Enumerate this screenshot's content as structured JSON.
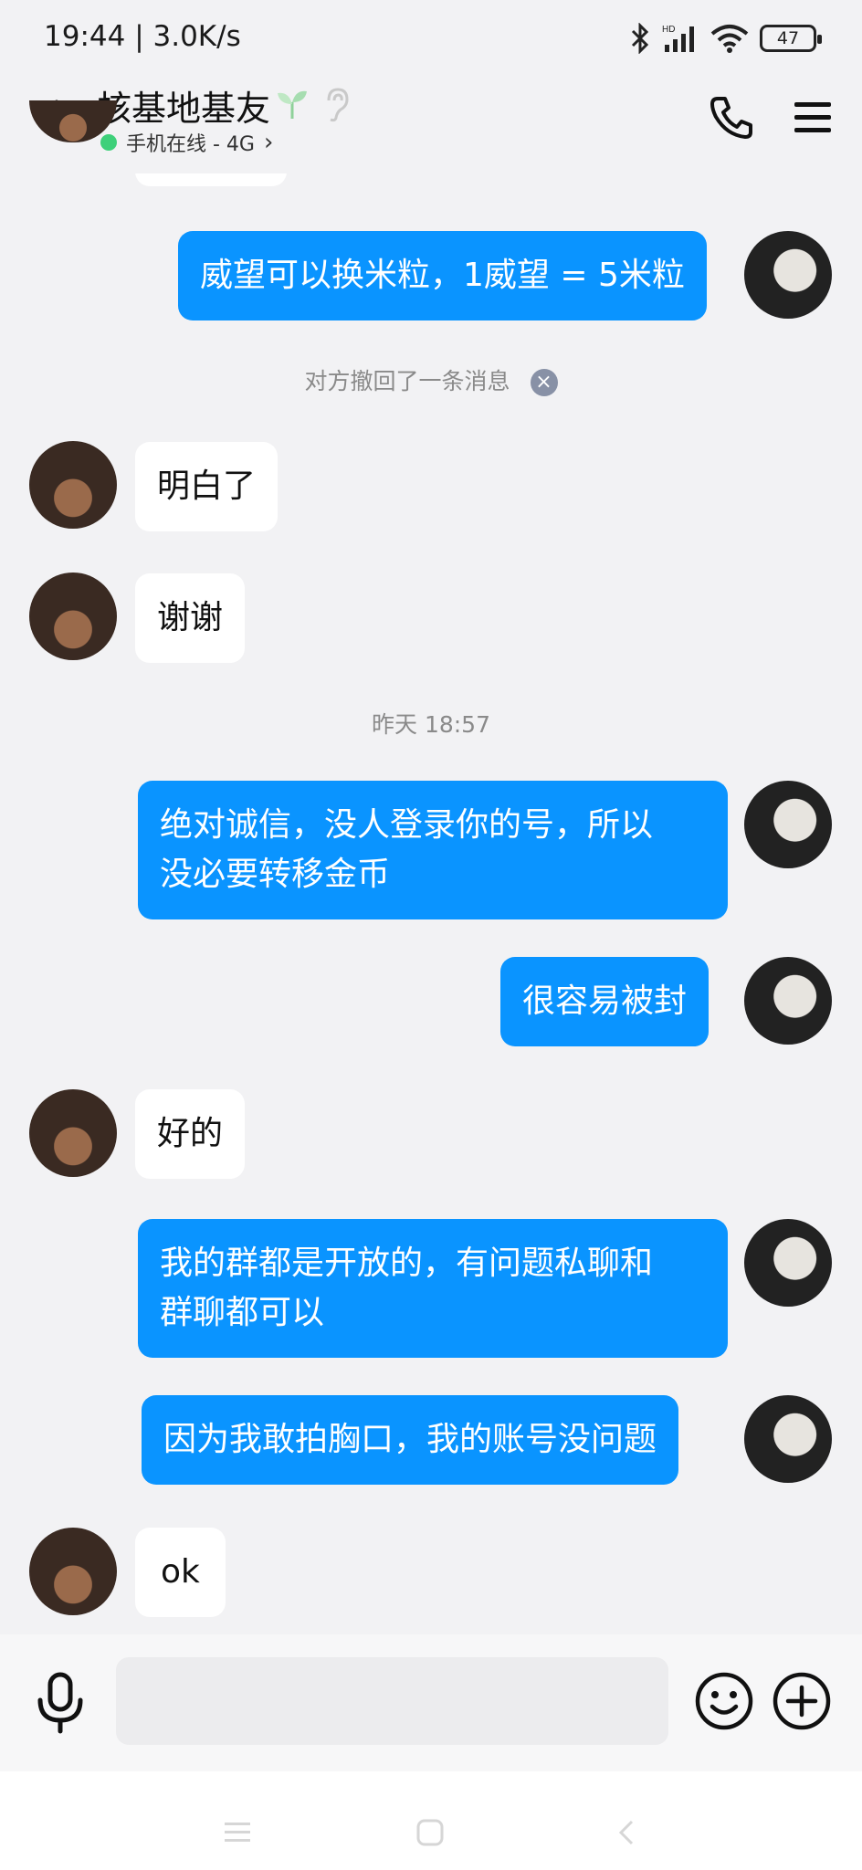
{
  "status_bar": {
    "time": "19:44 | 3.0K/s",
    "battery": "47"
  },
  "header": {
    "contact_name": "核基地基友",
    "online_status": "手机在线 - 4G",
    "online_chevron": "›"
  },
  "messages": [
    {
      "side": "out",
      "text": "威望可以换米粒，1威望 = 5米粒"
    },
    {
      "type": "system",
      "text": "对方撤回了一条消息"
    },
    {
      "side": "in",
      "text": "明白了"
    },
    {
      "side": "in",
      "text": "谢谢"
    },
    {
      "type": "time",
      "text": "昨天 18:57"
    },
    {
      "side": "out",
      "text": "绝对诚信，没人登录你的号，所以\n没必要转移金币"
    },
    {
      "side": "out",
      "text": "很容易被封"
    },
    {
      "side": "in",
      "text": "好的"
    },
    {
      "side": "out",
      "text": "我的群都是开放的，有问题私聊和\n群聊都可以"
    },
    {
      "side": "out",
      "text": "因为我敢拍胸口，我的账号没问题"
    },
    {
      "side": "in",
      "text": "ok"
    }
  ],
  "input_bar": {
    "placeholder": ""
  },
  "icons": {
    "back": "chevron-left-icon",
    "call": "phone-icon",
    "menu": "hamburger-menu-icon",
    "mic": "microphone-icon",
    "emoji": "smiley-icon",
    "plus": "plus-circle-icon",
    "recall_close": "close-circle-icon"
  },
  "colors": {
    "outgoing_bubble": "#0a94ff",
    "incoming_bubble": "#ffffff",
    "online_dot": "#3ed07a"
  }
}
